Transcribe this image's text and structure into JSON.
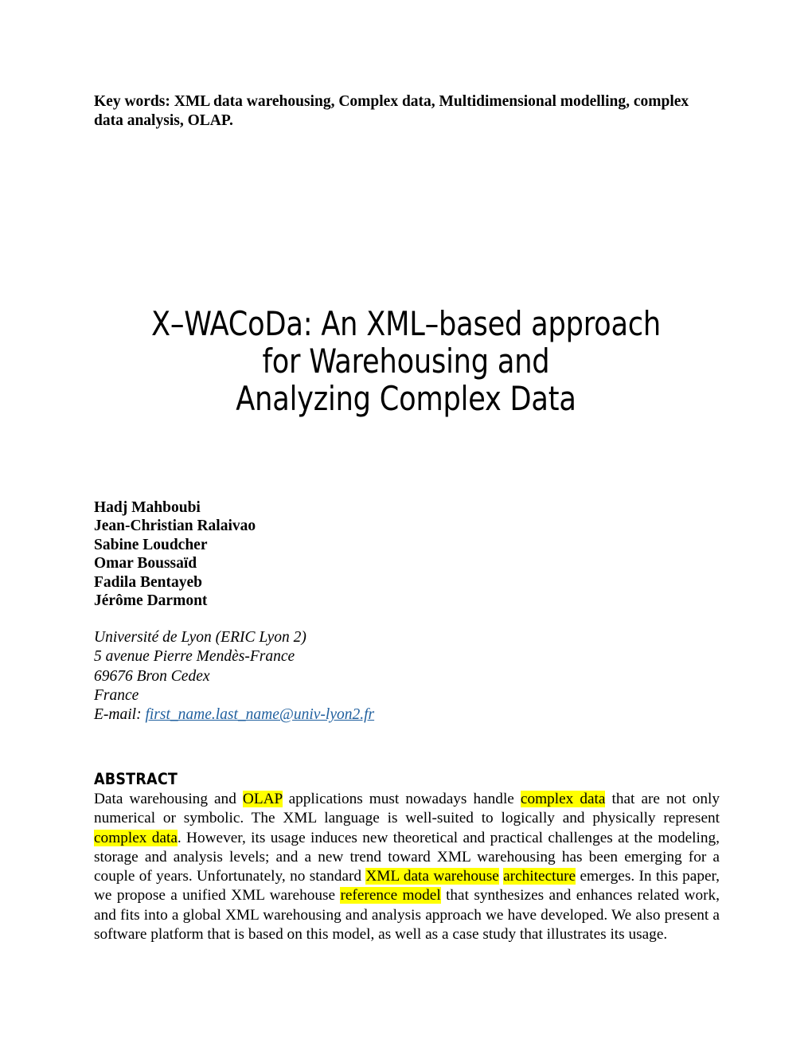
{
  "document": {
    "page_background": "#ffffff",
    "text_color": "#000000",
    "link_color": "#1f5f9e",
    "highlight_color": "#ffff00"
  },
  "keywords": {
    "label": "Key words:",
    "text": "Key words: XML data warehousing, Complex data, Multidimensional modelling, complex data analysis, OLAP."
  },
  "title": {
    "line1": "X–WACoDa: An XML–based approach",
    "line2": "for Warehousing and",
    "line3": "Analyzing Complex Data",
    "full": "X–WACoDa: An XML–based approach for Warehousing and Analyzing Complex Data"
  },
  "authors": {
    "list": [
      "Hadj Mahboubi",
      "Jean-Christian Ralaivao",
      "Sabine Loudcher",
      "Omar Boussaïd",
      "Fadila Bentayeb",
      "Jérôme Darmont"
    ]
  },
  "affiliation": {
    "lines": [
      "Université de Lyon (ERIC Lyon 2)",
      "5 avenue Pierre Mendès-France",
      "69676 Bron Cedex",
      "France"
    ],
    "email_label": "E-mail:",
    "email": "first_name.last_name@univ-lyon2.fr"
  },
  "abstract": {
    "heading": "ABSTRACT",
    "segments": [
      {
        "text": "Data warehousing and ",
        "highlight": false
      },
      {
        "text": "OLAP",
        "highlight": true
      },
      {
        "text": " applications must nowadays handle ",
        "highlight": false
      },
      {
        "text": "complex data",
        "highlight": true
      },
      {
        "text": " that are not only numerical or symbolic. The XML language is well-suited to logically and physically represent ",
        "highlight": false
      },
      {
        "text": "complex data",
        "highlight": true
      },
      {
        "text": ". However, its usage induces new theoretical and practical challenges at the modeling, storage and analysis levels; and a new trend toward XML warehousing has been emerging for a couple of years. Unfortunately, no standard ",
        "highlight": false
      },
      {
        "text": "XML data warehouse",
        "highlight": true
      },
      {
        "text": " ",
        "highlight": false
      },
      {
        "text": "architecture",
        "highlight": true
      },
      {
        "text": " emerges. In this paper, we propose a unified XML warehouse ",
        "highlight": false
      },
      {
        "text": "reference model",
        "highlight": true
      },
      {
        "text": " that synthesizes and enhances related work, and fits into a global XML warehousing and analysis approach we have developed. We also present a software platform that is based on this model, as well as a case study that illustrates its usage.",
        "highlight": false
      }
    ]
  }
}
